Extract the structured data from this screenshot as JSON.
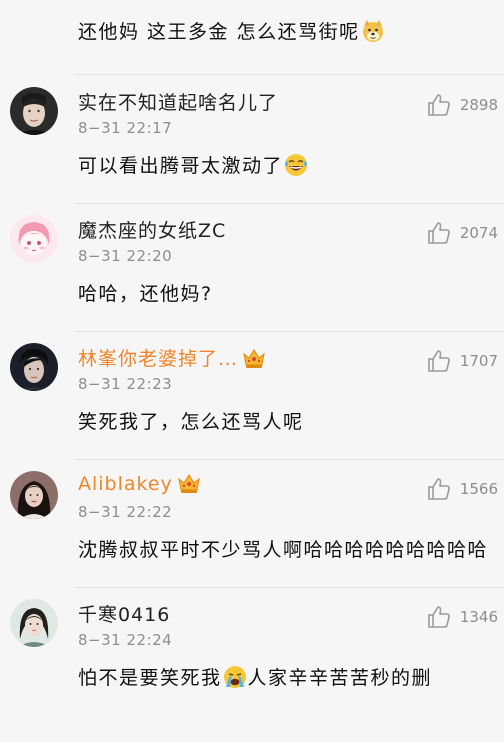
{
  "top_fragment": {
    "text": "还他妈  这王多金  怎么还骂街呢",
    "emoji": "doge-emoji"
  },
  "comments": [
    {
      "username": "实在不知道起啥名儿了",
      "vip": false,
      "timestamp": "8−31  22:17",
      "likes": "2898",
      "text": "可以看出腾哥太激动了",
      "emoji": "laugh-cry-emoji"
    },
    {
      "username": "魔杰座的女纸ZC",
      "vip": false,
      "timestamp": "8−31  22:20",
      "likes": "2074",
      "text": "哈哈，还他妈?"
    },
    {
      "username": "林峯你老婆掉了…",
      "vip": true,
      "timestamp": "8−31  22:23",
      "likes": "1707",
      "text": "笑死我了，怎么还骂人呢"
    },
    {
      "username": "Aliblakey",
      "vip": true,
      "timestamp": "8−31  22:22",
      "likes": "1566",
      "text": "沈腾叔叔平时不少骂人啊哈哈哈哈哈哈哈哈哈"
    },
    {
      "username": "千寒0416",
      "vip": false,
      "timestamp": "8−31  22:24",
      "likes": "1346",
      "text_before": "怕不是要笑死我",
      "text_after": "人家辛辛苦苦秒的删",
      "emoji": "crying-emoji"
    }
  ],
  "colors": {
    "background": "#f6f6f6",
    "text": "#111111",
    "meta": "#8d8d8d",
    "vip_name": "#f0862b",
    "divider": "#e2e2e2"
  },
  "icons": {
    "like": "thumbs-up-icon",
    "vip": "crown-icon"
  }
}
